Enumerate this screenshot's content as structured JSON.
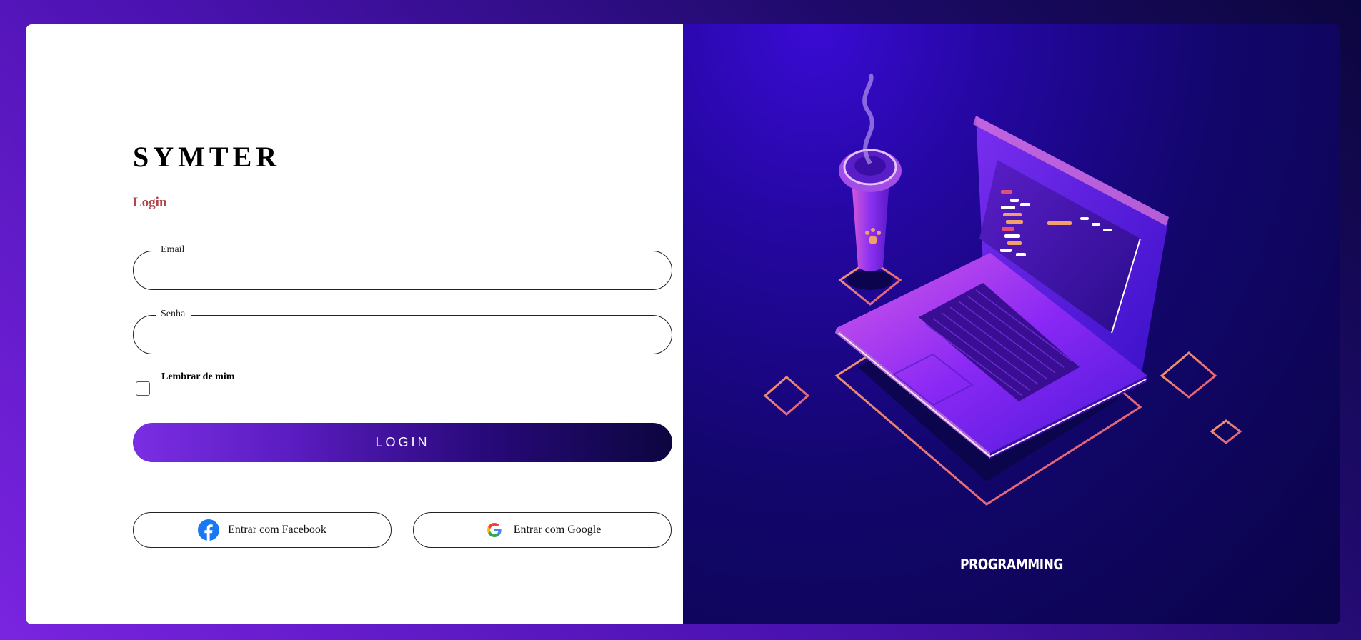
{
  "brand": {
    "name": "SYMTER"
  },
  "form": {
    "title": "Login",
    "email": {
      "label": "Email",
      "value": "",
      "placeholder": ""
    },
    "password": {
      "label": "Senha",
      "value": "",
      "placeholder": ""
    },
    "remember": {
      "label": "Lembrar de mim",
      "checked": false
    },
    "submit_label": "LOGIN"
  },
  "social": {
    "facebook_label": "Entrar com Facebook",
    "facebook_icon": "facebook-icon",
    "google_label": "Entrar com Google",
    "google_icon": "google-icon"
  },
  "illustration": {
    "caption": "PROGRAMMING"
  },
  "colors": {
    "accent": "#7b2ee3",
    "title": "#b0454a",
    "dark": "#0c063f"
  }
}
